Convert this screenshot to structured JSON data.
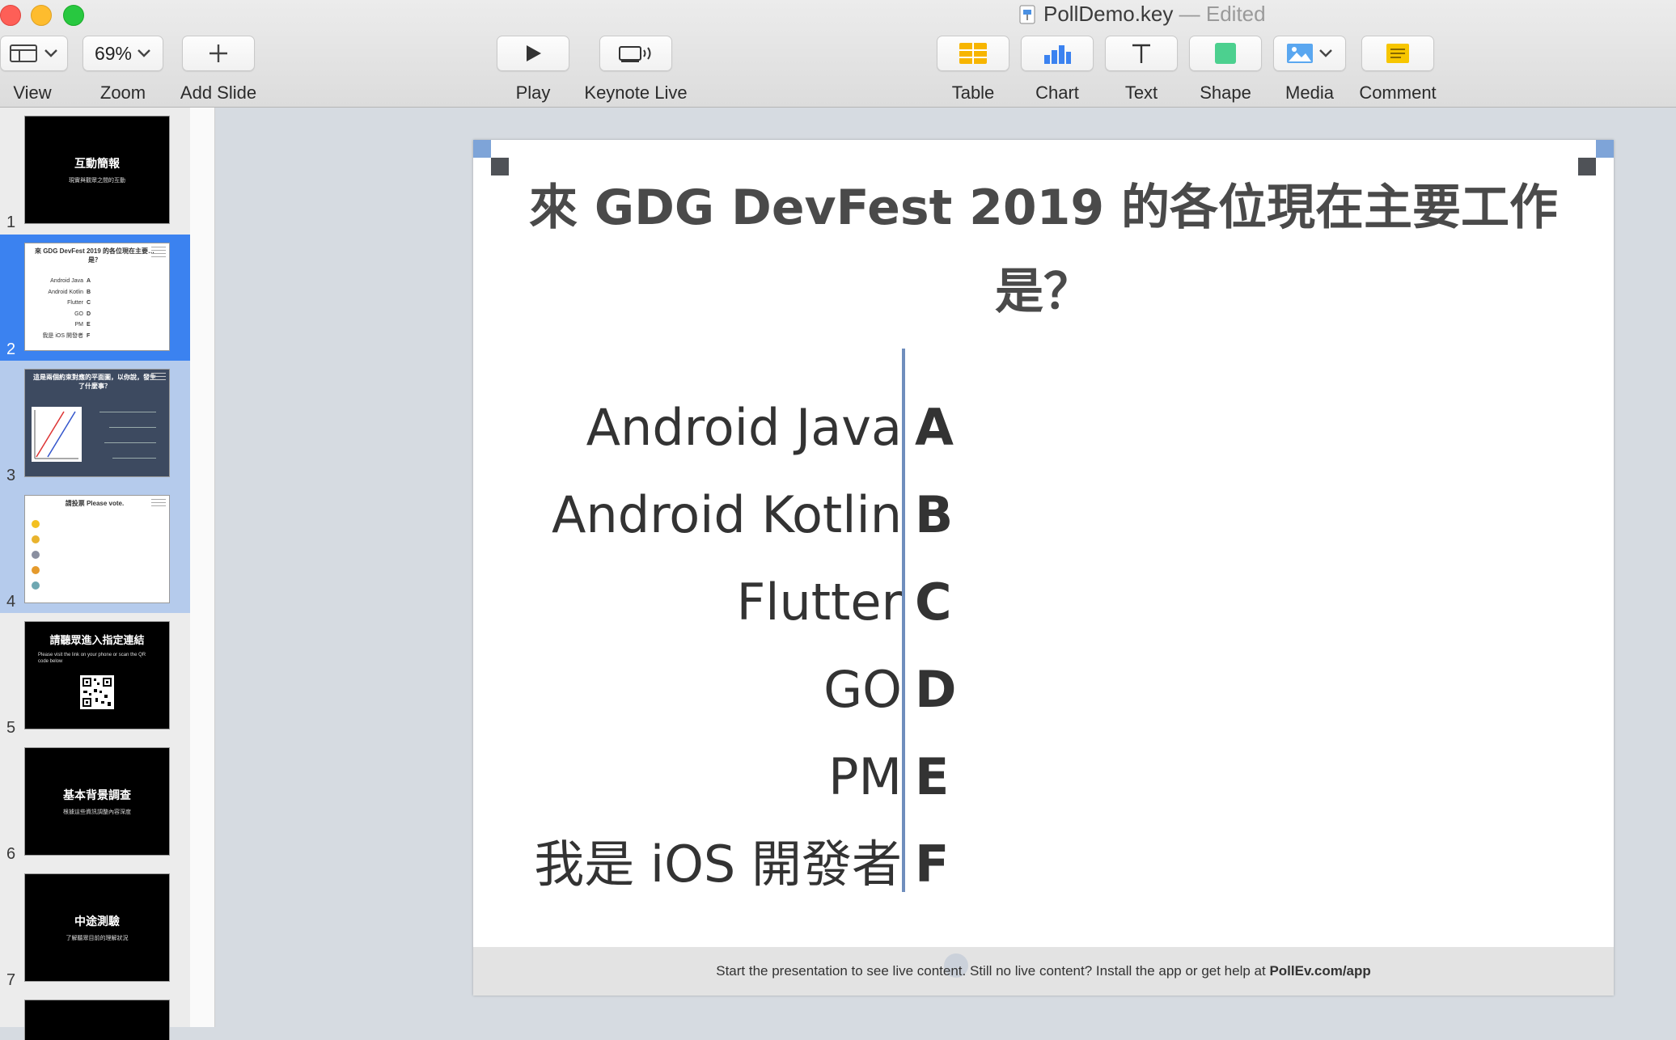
{
  "window": {
    "title": "PollDemo.key",
    "status": "— Edited"
  },
  "toolbar": {
    "view": "View",
    "zoom": "Zoom",
    "zoom_value": "69%",
    "add_slide": "Add Slide",
    "play": "Play",
    "keynote_live": "Keynote Live",
    "table": "Table",
    "chart": "Chart",
    "text": "Text",
    "shape": "Shape",
    "media": "Media",
    "comment": "Comment"
  },
  "colors": {
    "accent": "#3b82f0",
    "divider": "#6f8ebd",
    "selection_secondary": "#b5cbec"
  },
  "navigator": {
    "slides": [
      {
        "num": "1",
        "title": "互動簡報",
        "sub": "現實與觀眾之間的互動"
      },
      {
        "num": "2",
        "title": "來 GDG DevFest 2019 的各位現在主要… 是？",
        "options": [
          "Android Java",
          "Android Kotlin",
          "Flutter",
          "GO",
          "PM",
          "我是 iOS 開發者"
        ],
        "letters": [
          "A",
          "B",
          "C",
          "D",
          "E",
          "F"
        ]
      },
      {
        "num": "3",
        "title": "這是兩個約束對應的平面圖，以你說，發生了什麼事？"
      },
      {
        "num": "4",
        "title": "請投票 Please vote."
      },
      {
        "num": "5",
        "title": "請聽眾進入指定連結",
        "sub": "Please visit the link on your phone or scan the QR code below"
      },
      {
        "num": "6",
        "title": "基本背景調查",
        "sub": "根據這些資訊調整內容深度"
      },
      {
        "num": "7",
        "title": "中途測驗",
        "sub": "了解聽眾目前的理解狀況"
      }
    ]
  },
  "slide": {
    "title": "來 GDG DevFest 2019 的各位現在主要工作是？",
    "options": [
      {
        "label": "Android Java",
        "letter": "A"
      },
      {
        "label": "Android Kotlin",
        "letter": "B"
      },
      {
        "label": "Flutter",
        "letter": "C"
      },
      {
        "label": "GO",
        "letter": "D"
      },
      {
        "label": "PM",
        "letter": "E"
      },
      {
        "label": "我是 iOS 開發者",
        "letter": "F"
      }
    ],
    "footer_text": "Start the presentation to see live content. Still no live content? Install the app or get help at ",
    "footer_link": "PollEv.com/app"
  }
}
